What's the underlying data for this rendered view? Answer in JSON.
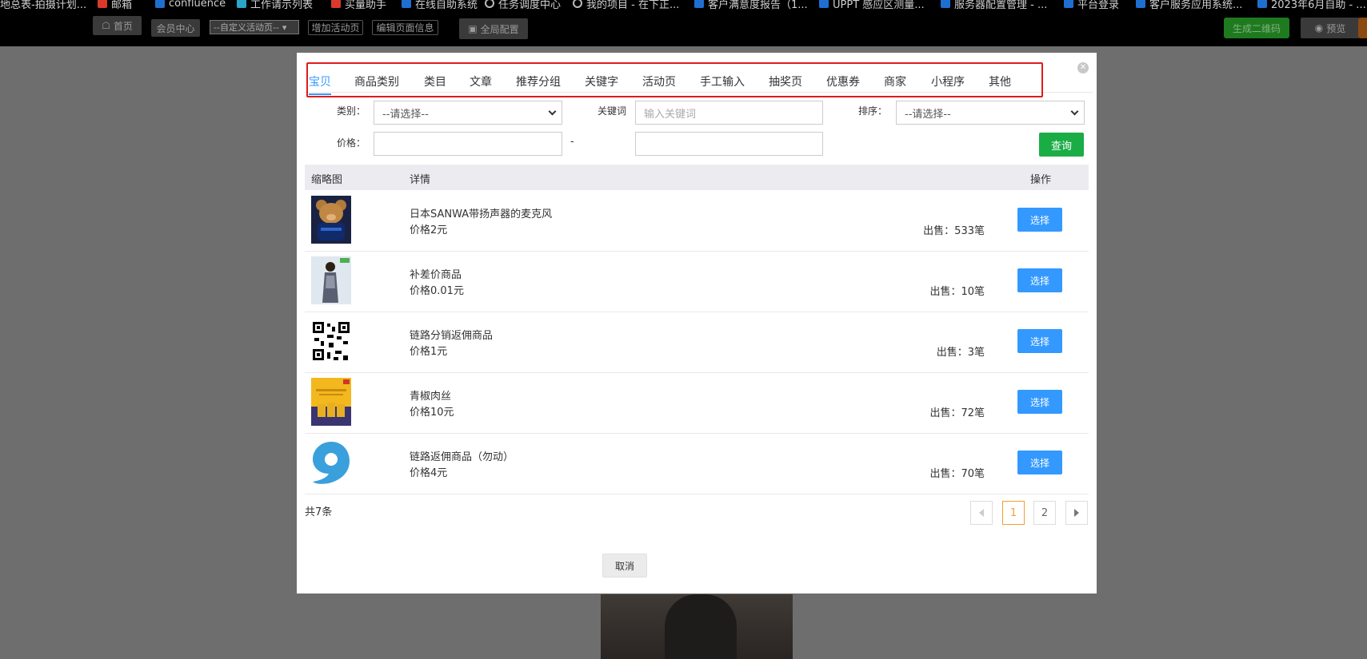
{
  "bookmarks": [
    {
      "label": "地总表-拍摄计划...",
      "icon": "bookmark-icon"
    },
    {
      "label": "邮箱",
      "icon": "mail-icon"
    },
    {
      "label": "confluence",
      "icon": "confluence-icon"
    },
    {
      "label": "工作请示列表",
      "icon": "list-icon"
    },
    {
      "label": "买量助手",
      "icon": "app-icon"
    },
    {
      "label": "在线自助系统",
      "icon": "app-icon"
    },
    {
      "label": "任务调度中心",
      "icon": "globe-icon"
    },
    {
      "label": "我的项目 - 在下正...",
      "icon": "globe-icon"
    },
    {
      "label": "客户满意度报告（1...",
      "icon": "doc-icon"
    },
    {
      "label": "UPPT 感应区测量...",
      "icon": "doc-icon"
    },
    {
      "label": "服务器配置管理 - ...",
      "icon": "doc-icon"
    },
    {
      "label": "平台登录",
      "icon": "app-icon"
    },
    {
      "label": "客户服务应用系统...",
      "icon": "doc-icon"
    },
    {
      "label": "2023年6月自助 - ...",
      "icon": "doc-icon"
    }
  ],
  "toolbar": {
    "home": "首页",
    "member_center": "会员中心",
    "page_select": "--自定义活动页--",
    "add_activity": "增加活动页",
    "edit_page_info": "编辑页面信息",
    "global_config": "全局配置",
    "generate_qr": "生成二维码",
    "preview": "预览"
  },
  "modal": {
    "tabs": [
      "宝贝",
      "商品类别",
      "类目",
      "文章",
      "推荐分组",
      "关键字",
      "活动页",
      "手工输入",
      "抽奖页",
      "优惠券",
      "商家",
      "小程序",
      "其他"
    ],
    "active_tab": "宝贝",
    "filters": {
      "category_label": "类别：",
      "category_value": "--请选择--",
      "keyword_label": "关键词",
      "keyword_placeholder": "输入关键词",
      "sort_label": "排序：",
      "sort_value": "--请选择--",
      "price_label": "价格：",
      "price_min": "",
      "price_max": "",
      "dash": "-",
      "query_button": "查询"
    },
    "table": {
      "headers": [
        "缩略图",
        "详情",
        "操作"
      ],
      "rows": [
        {
          "title": "日本SANWA带扬声器的麦克风",
          "price": "价格2元",
          "sold": "出售：533笔",
          "action": "选择",
          "thumb": "bear-thumbnail"
        },
        {
          "title": "补差价商品",
          "price": "价格0.01元",
          "sold": "出售：10笔",
          "action": "选择",
          "thumb": "model-thumbnail"
        },
        {
          "title": "链路分销返佣商品",
          "price": "价格1元",
          "sold": "出售：3笔",
          "action": "选择",
          "thumb": "qrcode-thumbnail"
        },
        {
          "title": "青椒肉丝",
          "price": "价格10元",
          "sold": "出售：72笔",
          "action": "选择",
          "thumb": "food-ad-thumbnail"
        },
        {
          "title": "链路返佣商品（勿动）",
          "price": "价格4元",
          "sold": "出售：70笔",
          "action": "选择",
          "thumb": "logo-thumbnail"
        }
      ]
    },
    "total": "共7条",
    "pagination": {
      "pages": [
        "1",
        "2"
      ],
      "current": "1"
    },
    "cancel": "取消"
  },
  "colors": {
    "accent": "#3399ff",
    "query_green": "#1aad45",
    "highlight_red": "#e01b1b",
    "current_page": "#f0a030"
  }
}
